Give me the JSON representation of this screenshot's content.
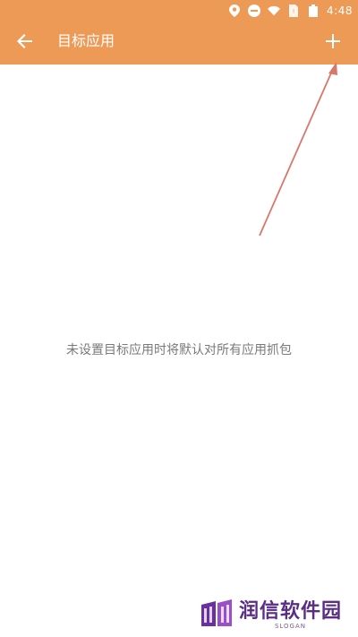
{
  "status_bar": {
    "time": "4:48",
    "icons": [
      "location-icon",
      "do-not-disturb-icon",
      "wifi-icon",
      "sim-card-icon",
      "battery-icon"
    ]
  },
  "toolbar": {
    "title": "目标应用",
    "back_icon": "arrow-back-icon",
    "add_icon": "plus-icon"
  },
  "main": {
    "empty_message": "未设置目标应用时将默认对所有应用抓包"
  },
  "watermark": {
    "title": "润信软件园",
    "subtitle": "SLOGAN"
  },
  "colors": {
    "appbar": "#ee9a57",
    "arrow": "#d9776b",
    "empty_text": "#7a7a7a",
    "watermark": "#5a2d86"
  }
}
